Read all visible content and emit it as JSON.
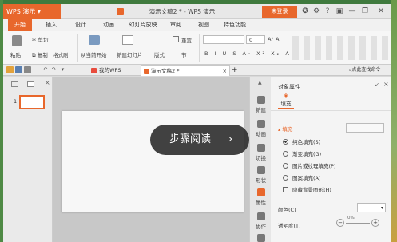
{
  "app": {
    "name": "WPS 演示",
    "doc_title": "演示文稿2 * - WPS 演示",
    "login": "未登录"
  },
  "menu": [
    "开始",
    "插入",
    "设计",
    "动画",
    "幻灯片放映",
    "审阅",
    "视图",
    "特色功能"
  ],
  "ribbon": {
    "paste": "粘贴",
    "cut": "剪切",
    "copy": "复制",
    "format_painter": "格式刷",
    "play_from_current": "从当前开始",
    "new_slide": "新建幻灯片",
    "layout": "版式",
    "section": "节",
    "reset": "重置",
    "font_size": "0"
  },
  "tabs": {
    "my_wps": "我的WPS",
    "doc": "演示文稿2 *",
    "add": "+"
  },
  "search": {
    "placeholder": "点此查找命令"
  },
  "left_panel": {
    "slide_number": "1"
  },
  "task_strip": [
    "新建",
    "动画",
    "切换",
    "形状",
    "属性",
    "协作",
    "帮助"
  ],
  "properties": {
    "title": "对象属性",
    "tab_fill": "填充",
    "section_fill": "填充",
    "options": [
      "纯色填充(S)",
      "渐变填充(G)",
      "图片或纹理填充(P)",
      "图案填充(A)",
      "隐藏背景图形(H)"
    ],
    "color_label": "颜色(C)",
    "transparency_label": "透明度(T)",
    "transparency_value": "0%"
  },
  "overlay": {
    "read_mode": "步骤阅读",
    "arrow": "›"
  },
  "colors": {
    "accent": "#e8672c"
  }
}
